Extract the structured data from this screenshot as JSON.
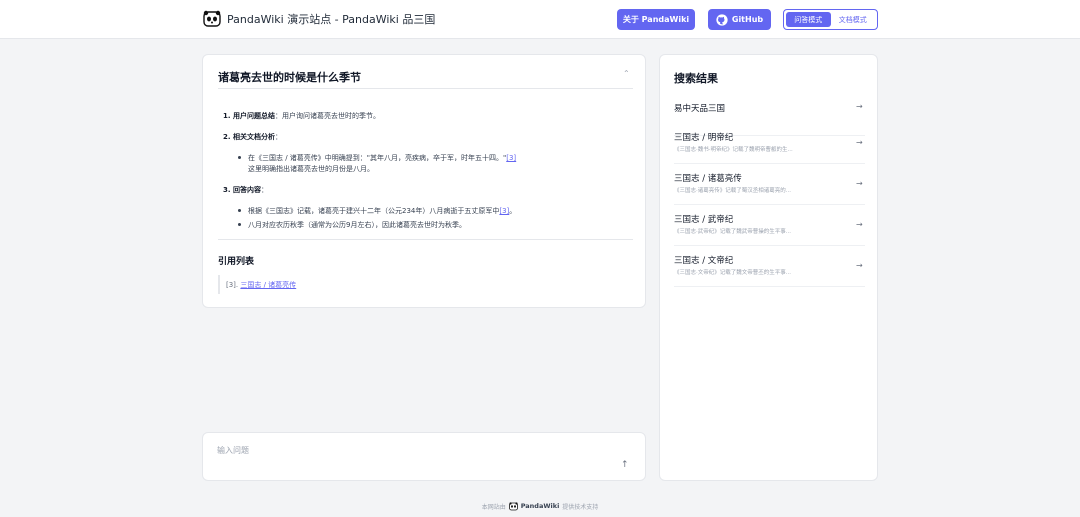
{
  "header": {
    "site_title": "PandaWiki 演示站点 - PandaWiki 品三国",
    "about_label": "关于 PandaWiki",
    "github_label": "GitHub",
    "mode_qa": "问答模式",
    "mode_doc": "文档模式",
    "accent_color": "#6366f1"
  },
  "question": {
    "title": "诸葛亮去世的时候是什么季节"
  },
  "answer": {
    "s1_label": "1. 用户问题总结",
    "s1_text": "：用户询问诸葛亮去世时的季节。",
    "s2_label": "2. 相关文档分析",
    "s2_colon": "：",
    "s2_b1": "在《三国志 / 诸葛亮传》中明确提到：\"其年八月，亮疾病，卒于军，时年五十四。\"",
    "s2_b1_cite": "[3]",
    "s2_b1_cont": "这里明确指出诸葛亮去世的月份是八月。",
    "s3_label": "3. 回答内容",
    "s3_colon": "：",
    "s3_b1": "根据《三国志》记载，诸葛亮于建兴十二年（公元234年）八月病逝于五丈原军中",
    "s3_b1_cite": "[3]",
    "s3_b1_end": "。",
    "s3_b2": "八月对应农历秋季（通常为公历9月左右），因此诸葛亮去世时为秋季。"
  },
  "references": {
    "heading": "引用列表",
    "item_index": "[3].",
    "item_link": "三国志 / 诸葛亮传"
  },
  "input": {
    "placeholder": "输入问题"
  },
  "results": {
    "title": "搜索结果",
    "items": [
      {
        "title": "易中天品三国",
        "snippet": ""
      },
      {
        "title": "三国志 / 明帝纪",
        "snippet": "《三国志·魏书·明帝纪》记载了魏明帝曹叡的生..."
      },
      {
        "title": "三国志 / 诸葛亮传",
        "snippet": "《三国志·诸葛亮传》记载了蜀汉丞相诸葛亮的..."
      },
      {
        "title": "三国志 / 武帝纪",
        "snippet": "《三国志·武帝纪》记载了魏武帝曹操的生平事..."
      },
      {
        "title": "三国志 / 文帝纪",
        "snippet": "《三国志·文帝纪》记载了魏文帝曹丕的生平事..."
      }
    ]
  },
  "footer": {
    "prefix": "本网站由",
    "brand": "PandaWiki",
    "suffix": "提供技术支持"
  }
}
